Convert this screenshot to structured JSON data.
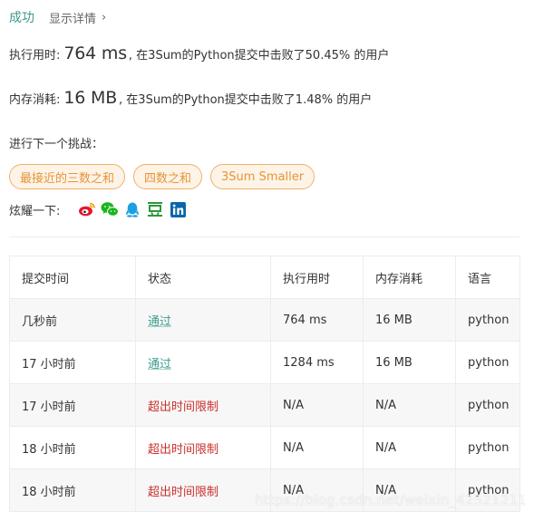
{
  "header": {
    "status": "成功",
    "details_link": "显示详情"
  },
  "runtime": {
    "label": "执行用时:",
    "value": "764 ms",
    "suffix": ", 在3Sum的Python提交中击败了50.45% 的用户"
  },
  "memory": {
    "label": "内存消耗:",
    "value": "16 MB",
    "suffix": ", 在3Sum的Python提交中击败了1.48% 的用户"
  },
  "challenge": {
    "label": "进行下一个挑战：",
    "items": [
      "最接近的三数之和",
      "四数之和",
      "3Sum Smaller"
    ]
  },
  "share": {
    "label": "炫耀一下:",
    "icons": [
      "weibo-icon",
      "wechat-icon",
      "qq-icon",
      "douban-icon",
      "linkedin-icon"
    ]
  },
  "table": {
    "headers": [
      "提交时间",
      "状态",
      "执行用时",
      "内存消耗",
      "语言"
    ],
    "rows": [
      [
        "几秒前",
        "通过",
        "764 ms",
        "16 MB",
        "python"
      ],
      [
        "17 小时前",
        "通过",
        "1284 ms",
        "16 MB",
        "python"
      ],
      [
        "17 小时前",
        "超出时间限制",
        "N/A",
        "N/A",
        "python"
      ],
      [
        "18 小时前",
        "超出时间限制",
        "N/A",
        "N/A",
        "python"
      ],
      [
        "18 小时前",
        "超出时间限制",
        "N/A",
        "N/A",
        "python"
      ]
    ]
  },
  "watermark": "https://blog.csdn.net/weixin_42521211",
  "colors": {
    "success": "#3c9a8e",
    "error": "#c9302c",
    "challenge_border": "#f1b26a",
    "challenge_text": "#e5953a"
  }
}
